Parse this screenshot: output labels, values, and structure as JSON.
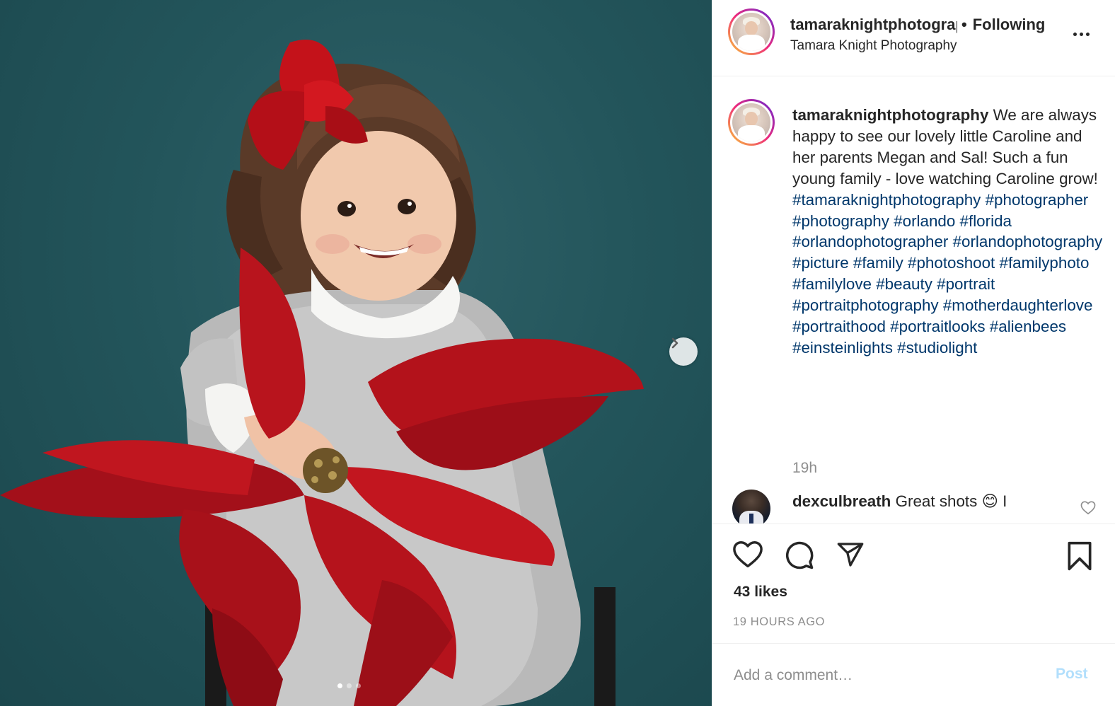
{
  "post": {
    "username": "tamaraknightphotography",
    "following_label": "Following",
    "separator": "•",
    "location": "Tamara Knight Photography",
    "caption_text": "We are always happy to see our lovely little Caroline and her parents Megan and Sal! Such a fun young family - love watching Caroline grow!",
    "hashtags": "#tamaraknightphotography #photographer #photography #orlando #florida #orlandophotographer #orlandophotography #picture #family #photoshoot #familyphoto #familylove #beauty #portrait #portraitphotography #motherdaughterlove #portraithood #portraitlooks #alienbees #einsteinlights #studiolight",
    "caption_time": "19h",
    "likes": "43 likes",
    "time_ago": "19 HOURS AGO",
    "carousel": {
      "count": 3,
      "active_index": 0
    }
  },
  "comments": [
    {
      "username": "dexculbreath",
      "text": "Great shots 😊 I"
    }
  ],
  "add_comment": {
    "placeholder": "Add a comment…",
    "post_label": "Post"
  },
  "icons": {
    "next": "chevron-right-icon",
    "more": "more-options-icon",
    "like": "heart-icon",
    "comment": "comment-icon",
    "share": "paper-plane-icon",
    "save": "bookmark-icon"
  },
  "colors": {
    "hashtag": "#00376b",
    "secondary_text": "#8e8e8e",
    "post_button_disabled": "#b2dffc",
    "photo_background": "#23555b"
  }
}
